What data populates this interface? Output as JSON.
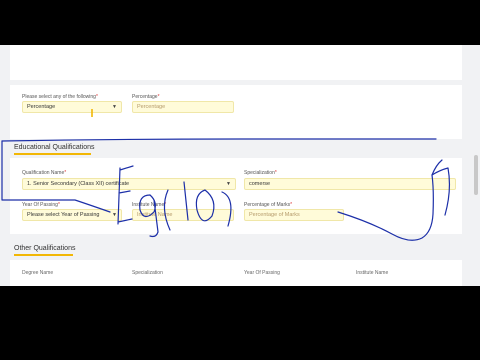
{
  "selection_card": {
    "select_label": "Please select any of the following",
    "select_value": "Percentage",
    "percentage_label": "Percentage",
    "percentage_placeholder": "Percentage"
  },
  "educational": {
    "title": "Educational Qualifications",
    "qualification_label": "Qualification Name",
    "qualification_value": "1. Senior Secondary (Class XII) certificate",
    "specialization_label": "Specialization",
    "specialization_value": "comerse",
    "year_label": "Year Of Passing",
    "year_value": "Please select Year of Passing",
    "institute_label": "Institute Name",
    "institute_placeholder": "Institute Name",
    "marks_label": "Percentage of Marks",
    "marks_placeholder": "Percentage of Marks"
  },
  "other": {
    "title": "Other Qualifications",
    "columns": [
      "Degree Name",
      "Specialization",
      "Year Of Passing",
      "Institute Name"
    ]
  },
  "handwriting": "Eq(10)",
  "colors": {
    "accent": "#f2b705",
    "ink": "#1c2fa8",
    "field_bg": "#fffbd9"
  }
}
